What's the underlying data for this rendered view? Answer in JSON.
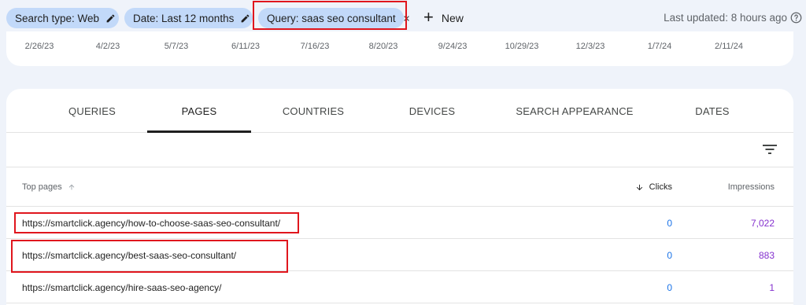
{
  "filters": {
    "search_type": "Search type: Web",
    "date": "Date: Last 12 months",
    "query": "Query: saas seo consultant",
    "new_label": "New",
    "last_updated": "Last updated: 8 hours ago"
  },
  "chart_axis": {
    "x_ticks": [
      "2/26/23",
      "4/2/23",
      "5/7/23",
      "6/11/23",
      "7/16/23",
      "8/20/23",
      "9/24/23",
      "10/29/23",
      "12/3/23",
      "1/7/24",
      "2/11/24"
    ]
  },
  "tabs": [
    {
      "label": "QUERIES"
    },
    {
      "label": "PAGES"
    },
    {
      "label": "COUNTRIES"
    },
    {
      "label": "DEVICES"
    },
    {
      "label": "SEARCH APPEARANCE"
    },
    {
      "label": "DATES"
    }
  ],
  "active_tab": "PAGES",
  "table": {
    "headers": {
      "pages": "Top pages",
      "clicks": "Clicks",
      "impressions": "Impressions"
    },
    "rows": [
      {
        "url": "https://smartclick.agency/how-to-choose-saas-seo-consultant/",
        "clicks": "0",
        "impressions": "7,022"
      },
      {
        "url": "https://smartclick.agency/best-saas-seo-consultant/",
        "clicks": "0",
        "impressions": "883"
      },
      {
        "url": "https://smartclick.agency/hire-saas-seo-agency/",
        "clicks": "0",
        "impressions": "1"
      }
    ]
  },
  "colors": {
    "chip_bg": "#c2d9f9",
    "highlight": "#e0161d",
    "clicks": "#1a73e8",
    "impressions": "#8430ce"
  }
}
